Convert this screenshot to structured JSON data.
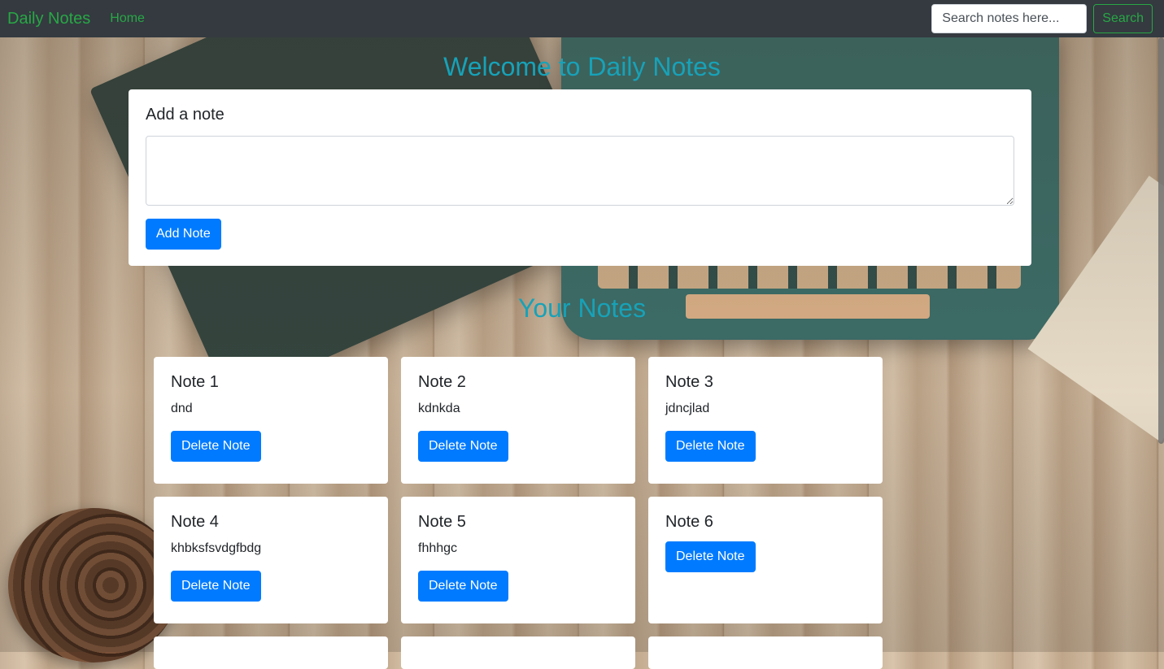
{
  "navbar": {
    "brand": "Daily Notes",
    "home": "Home",
    "search_placeholder": "Search notes here...",
    "search_button": "Search"
  },
  "welcome_heading": "Welcome to Daily Notes",
  "add_note": {
    "title": "Add a note",
    "button": "Add Note"
  },
  "notes_heading": "Your Notes",
  "notes": [
    {
      "title": "Note 1",
      "text": "dnd",
      "delete_label": "Delete Note"
    },
    {
      "title": "Note 2",
      "text": "kdnkda",
      "delete_label": "Delete Note"
    },
    {
      "title": "Note 3",
      "text": "jdncjlad",
      "delete_label": "Delete Note"
    },
    {
      "title": "Note 4",
      "text": "khbksfsvdgfbdg",
      "delete_label": "Delete Note"
    },
    {
      "title": "Note 5",
      "text": "fhhhgc",
      "delete_label": "Delete Note"
    },
    {
      "title": "Note 6",
      "text": "",
      "delete_label": "Delete Note"
    }
  ],
  "colors": {
    "navbar": "#343a40",
    "brand": "#28a745",
    "heading": "#17a2b8",
    "primary": "#007bff"
  }
}
